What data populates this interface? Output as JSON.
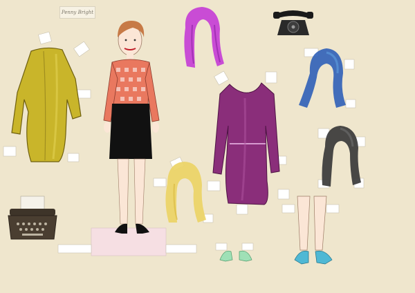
{
  "page": {
    "background": "#efe6cd"
  },
  "signature_card": {
    "text": "Penny Bright",
    "color": "#7a7568"
  },
  "icons": {
    "telephone": "rotary-telephone-icon",
    "typewriter": "typewriter-icon"
  },
  "colors": {
    "yellow_dress": "#c9b52a",
    "purple_dress": "#8a2e7a",
    "magenta_wig": "#c43bd6",
    "blue_wig": "#2f5fb8",
    "black_wig": "#3a3a3a",
    "blonde_wig": "#ecd466",
    "skirt": "#111111",
    "blouse": "#e9785f",
    "stand": "#f6dfe3",
    "mint_shoes": "#9fe0b6",
    "teal_shoes": "#4fb8d4"
  }
}
